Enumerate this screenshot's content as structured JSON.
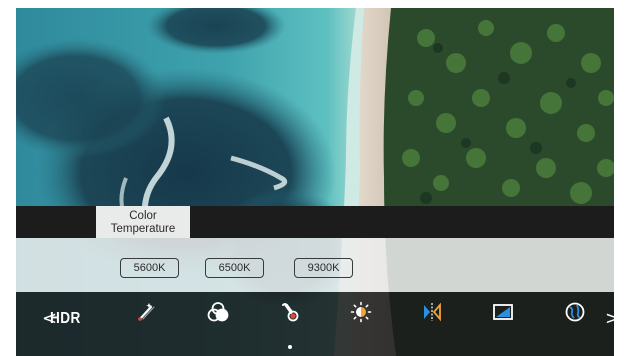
{
  "osd": {
    "active_tab_label": "Color\nTemperature",
    "options": [
      {
        "label": "5600K",
        "selected": false
      },
      {
        "label": "6500K",
        "selected": false
      },
      {
        "label": "9300K",
        "selected": false
      }
    ],
    "menu": {
      "prev_arrow": "<",
      "hdr_label": "HDR",
      "next_arrow": ">",
      "icons": [
        "magic-wand-icon",
        "color-circles-icon",
        "thermometer-icon",
        "brightness-icon",
        "hdr-compare-icon",
        "picture-icon",
        "globe-icon"
      ],
      "active_icon": "thermometer-icon"
    }
  },
  "colors": {
    "accent_red": "#e0483a",
    "hdr_blue": "#2a8fe0",
    "brightness_orange": "#f2a33a"
  }
}
